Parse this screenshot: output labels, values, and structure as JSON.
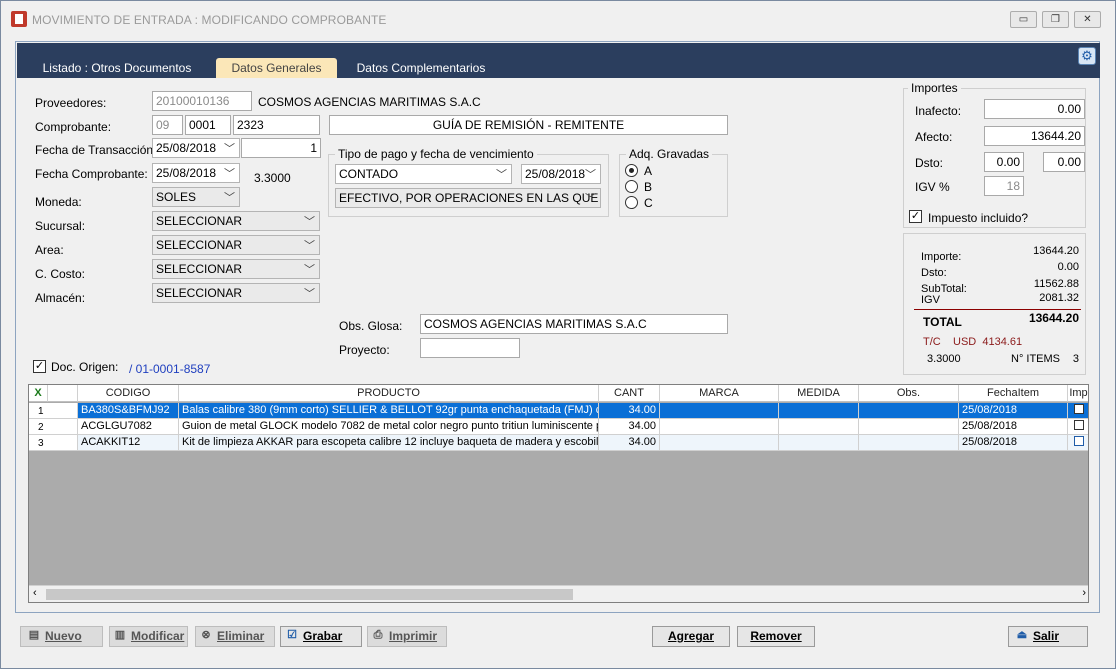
{
  "window": {
    "title": "MOVIMIENTO DE ENTRADA : MODIFICANDO COMPROBANTE",
    "minimize": "▭",
    "restore": "❐",
    "close": "✕"
  },
  "tabs": [
    "Listado : Otros Documentos",
    "Datos Generales",
    "Datos Complementarios"
  ],
  "settings_icon": "gear-icon",
  "form": {
    "proveedores_label": "Proveedores:",
    "proveedor_ruc": "20100010136",
    "proveedor_nombre": "COSMOS AGENCIAS MARITIMAS S.A.C",
    "comprobante_label": "Comprobante:",
    "comprobante_tipo": "09",
    "comprobante_serie": "0001",
    "comprobante_numero": "2323",
    "comprobante_desc": "GUÍA DE REMISIÓN - REMITENTE",
    "fecha_transaccion_label": "Fecha de Transacción:",
    "fecha_transaccion": "25/08/2018",
    "fecha_transaccion_num": "1",
    "fecha_comprobante_label": "Fecha Comprobante:",
    "fecha_comprobante": "25/08/2018",
    "tipo_cambio": "3.3000",
    "moneda_label": "Moneda:",
    "moneda": "SOLES",
    "sucursal_label": "Sucursal:",
    "sucursal": "SELECCIONAR",
    "area_label": "Area:",
    "area": "SELECCIONAR",
    "ccosto_label": "C. Costo:",
    "ccosto": "SELECCIONAR",
    "almacen_label": "Almacén:",
    "almacen": "SELECCIONAR",
    "pago_group": "Tipo de pago y fecha de vencimiento",
    "pago_tipo": "CONTADO",
    "pago_fecha": "25/08/2018",
    "pago_medio": "EFECTIVO, POR OPERACIONES EN LAS QUE NO",
    "adq_group": "Adq. Gravadas",
    "adq_options": [
      "A",
      "B",
      "C"
    ],
    "adq_selected": "A",
    "obs_glosa_label": "Obs. Glosa:",
    "obs_glosa": "COSMOS AGENCIAS MARITIMAS S.A.C",
    "proyecto_label": "Proyecto:",
    "proyecto": "",
    "doc_origen_label": "Doc. Origen:",
    "doc_origen_checked": true,
    "doc_origen_link": "/ 01-0001-8587"
  },
  "importes": {
    "group": "Importes",
    "inafecto_label": "Inafecto:",
    "inafecto": "0.00",
    "afecto_label": "Afecto:",
    "afecto": "13644.20",
    "dsto_label": "Dsto:",
    "dsto1": "0.00",
    "dsto2": "0.00",
    "igv_label": "IGV %",
    "igv": "18",
    "impuesto_incluido_label": "Impuesto incluido?",
    "impuesto_incluido": true
  },
  "totales": {
    "importe_label": "Importe:",
    "importe": "13644.20",
    "dsto_label": "Dsto:",
    "dsto": "0.00",
    "subtotal_label": "SubTotal:",
    "subtotal": "11562.88",
    "igv_label": "IGV",
    "igv": "2081.32",
    "total_label": "TOTAL",
    "total": "13644.20",
    "tc_label": "T/C",
    "tc_value": "USD  4134.61",
    "tipo_cambio": "3.3000",
    "items_label": "N° ITEMS",
    "items": "3"
  },
  "grid": {
    "excel_icon": "excel-icon",
    "columns": [
      "CODIGO",
      "PRODUCTO",
      "CANT",
      "MARCA",
      "MEDIDA",
      "Obs.",
      "FechaItem",
      "Imp"
    ],
    "rows": [
      {
        "n": "1",
        "codigo": "BA380S&BFMJ92",
        "producto": "Balas calibre 380 (9mm corto) SELLIER & BELLOT 92gr punta enchaquetada (FMJ) ca...",
        "cant": "34.00",
        "marca": "",
        "medida": "",
        "obs": "",
        "fecha": "25/08/2018"
      },
      {
        "n": "2",
        "codigo": "ACGLGU7082",
        "producto": "Guion de metal GLOCK modelo 7082 de metal color negro punto tritiun luminiscente p...",
        "cant": "34.00",
        "marca": "",
        "medida": "",
        "obs": "",
        "fecha": "25/08/2018"
      },
      {
        "n": "3",
        "codigo": "ACAKKIT12",
        "producto": "Kit de limpieza AKKAR para escopeta calibre 12 incluye baqueta de madera y escobill...",
        "cant": "34.00",
        "marca": "",
        "medida": "",
        "obs": "",
        "fecha": "25/08/2018"
      }
    ]
  },
  "buttons": {
    "nuevo": "Nuevo",
    "modificar": "Modificar",
    "eliminar": "Eliminar",
    "grabar": "Grabar",
    "imprimir": "Imprimir",
    "agregar": "Agregar",
    "remover": "Remover",
    "salir": "Salir"
  },
  "colors": {
    "tab_bar": "#2b3e5e",
    "active_tab": "#fbe7b8",
    "selection": "#0a6fd6",
    "total_rule": "#8b0000",
    "tc_text": "#8b1a1a",
    "link": "#1f3fbf"
  }
}
